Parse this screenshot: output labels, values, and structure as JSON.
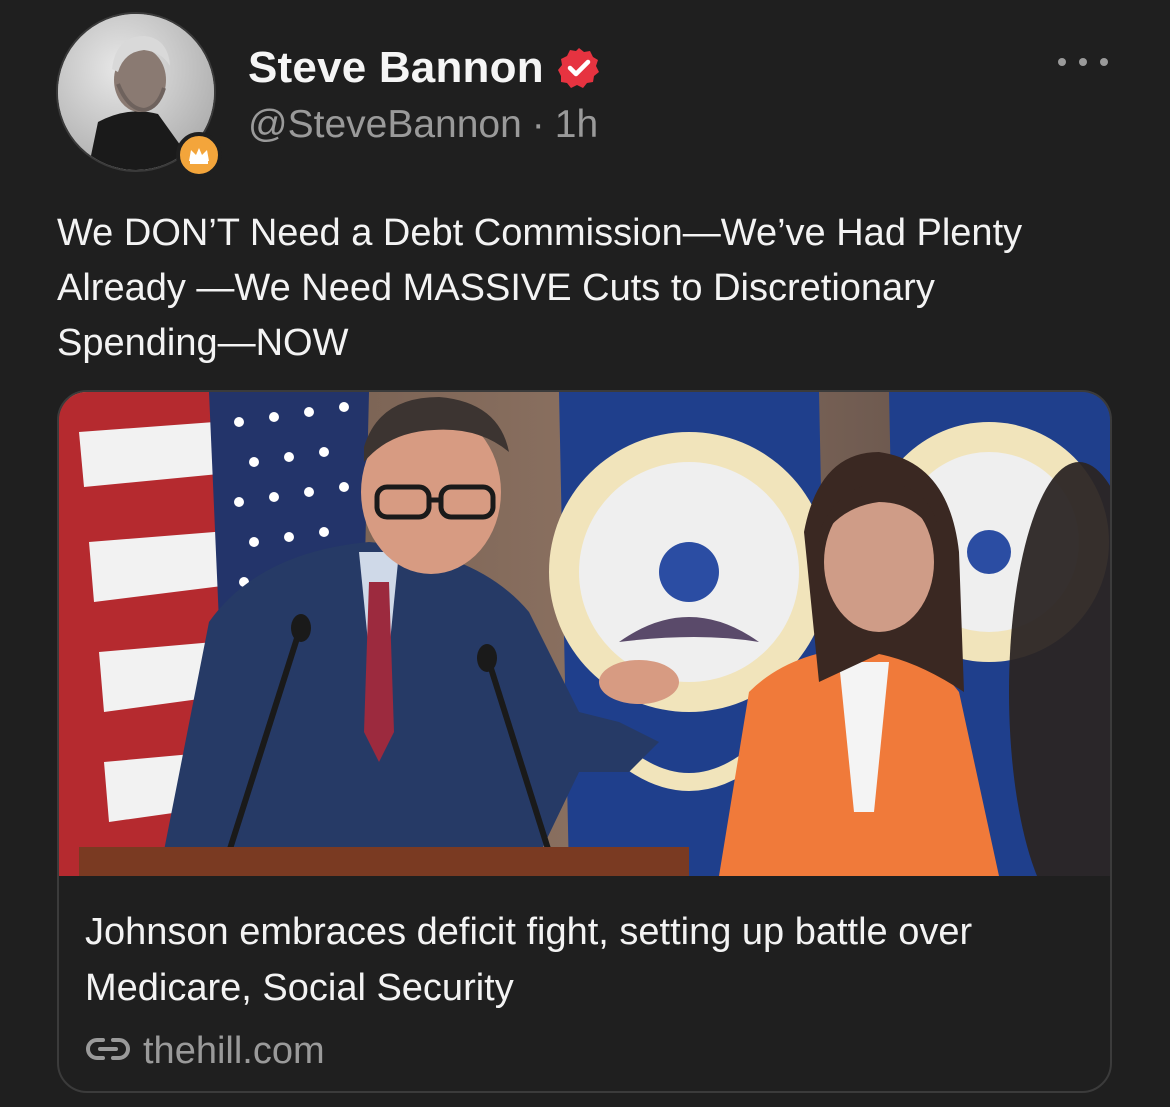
{
  "author": {
    "display_name": "Steve Bannon",
    "handle": "@SteveBannon",
    "separator": "·",
    "timestamp": "1h",
    "avatar_icon": "avatar-photo",
    "badge_icon": "crown-icon",
    "verified_icon": "verified-check-icon"
  },
  "post": {
    "text": "We DON’T Need a Debt Commission—We’ve Had Plenty\nAlready —We Need MASSIVE Cuts to Discretionary\nSpending—NOW"
  },
  "link_card": {
    "title": "Johnson embraces deficit fight, setting up battle over Medicare, Social Security",
    "domain": "thehill.com",
    "link_icon": "link-icon"
  },
  "colors": {
    "background": "#1f1f1f",
    "verified": "#e63340",
    "crown_badge": "#f3a53b",
    "muted_text": "#9a9a9a",
    "primary_text": "#f3f3f3",
    "card_border": "#3b3b3b"
  }
}
